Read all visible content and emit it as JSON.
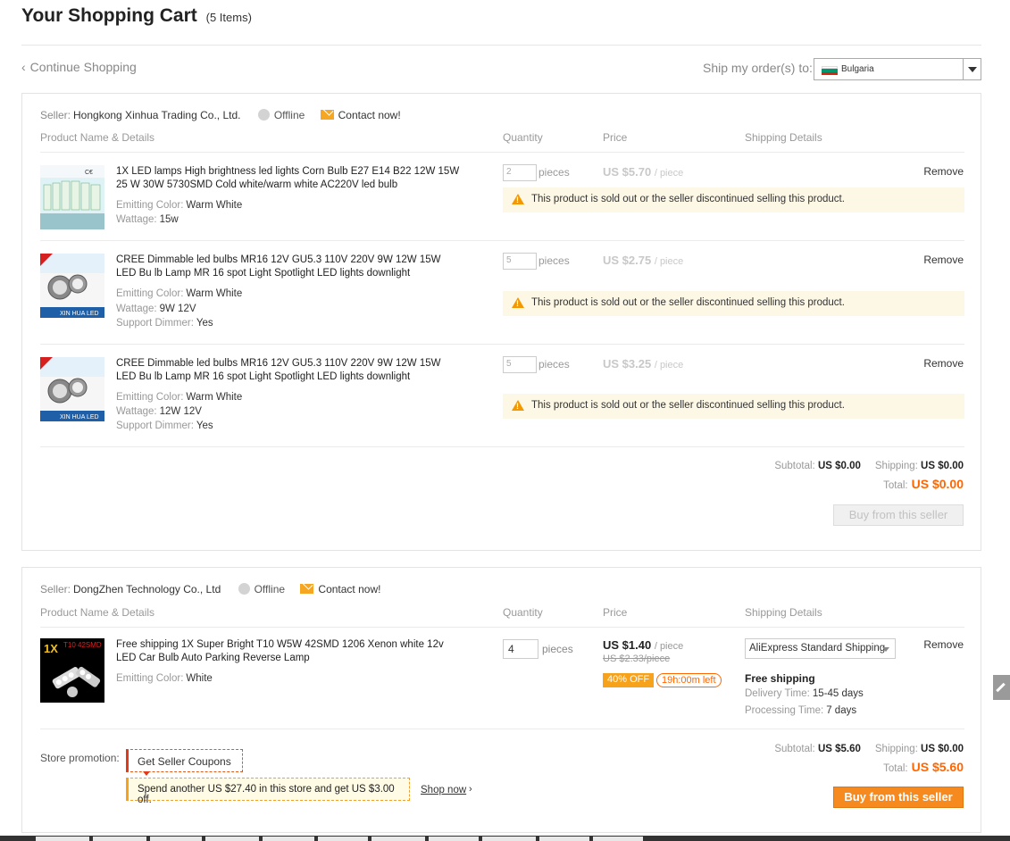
{
  "header": {
    "title": "Your Shopping Cart",
    "item_count": "(5 Items)",
    "continue_shopping": "Continue Shopping",
    "ship_to_label": "Ship my order(s) to:",
    "country": "Bulgaria"
  },
  "columns": {
    "product": "Product Name & Details",
    "quantity": "Quantity",
    "price": "Price",
    "shipping": "Shipping Details"
  },
  "stores": [
    {
      "seller_label": "Seller:",
      "seller_name": "Hongkong Xinhua Trading Co., Ltd.",
      "status": "Offline",
      "contact": "Contact now!",
      "items": [
        {
          "name": "1X LED lamps High brightness led lights Corn Bulb E27 E14 B22 12W 15W 25 W 30W 5730SMD Cold white/warm white AC220V led bulb",
          "attrs": [
            {
              "label": "Emitting Color:",
              "value": "Warm White"
            },
            {
              "label": "Wattage:",
              "value": "15w"
            }
          ],
          "quantity": "2",
          "unit": "pieces",
          "price": "US $5.70",
          "price_unit": "/ piece",
          "remove": "Remove",
          "warning": "This product is sold out or the seller discontinued selling this product."
        },
        {
          "name": "CREE Dimmable led bulbs MR16 12V GU5.3 110V 220V 9W 12W 15W LED Bu lb Lamp MR 16 spot Light Spotlight LED lights downlight",
          "attrs": [
            {
              "label": "Emitting Color:",
              "value": "Warm White"
            },
            {
              "label": "Wattage:",
              "value": "9W 12V"
            },
            {
              "label": "Support Dimmer:",
              "value": "Yes"
            }
          ],
          "quantity": "5",
          "unit": "pieces",
          "price": "US $2.75",
          "price_unit": "/ piece",
          "remove": "Remove",
          "warning": "This product is sold out or the seller discontinued selling this product."
        },
        {
          "name": "CREE Dimmable led bulbs MR16 12V GU5.3 110V 220V 9W 12W 15W LED Bu lb Lamp MR 16 spot Light Spotlight LED lights downlight",
          "attrs": [
            {
              "label": "Emitting Color:",
              "value": "Warm White"
            },
            {
              "label": "Wattage:",
              "value": "12W 12V"
            },
            {
              "label": "Support Dimmer:",
              "value": "Yes"
            }
          ],
          "quantity": "5",
          "unit": "pieces",
          "price": "US $3.25",
          "price_unit": "/ piece",
          "remove": "Remove",
          "warning": "This product is sold out or the seller discontinued selling this product."
        }
      ],
      "subtotal_label": "Subtotal:",
      "subtotal": "US $0.00",
      "shipping_label": "Shipping:",
      "shipping": "US $0.00",
      "total_label": "Total:",
      "total": "US $0.00",
      "buy_label": "Buy from this seller"
    },
    {
      "seller_label": "Seller:",
      "seller_name": "DongZhen Technology Co., Ltd",
      "status": "Offline",
      "contact": "Contact now!",
      "items": [
        {
          "name": "Free shipping 1X Super Bright T10 W5W 42SMD 1206 Xenon white 12v LED Car Bulb Auto Parking Reverse Lamp",
          "attrs": [
            {
              "label": "Emitting Color:",
              "value": "White"
            }
          ],
          "quantity": "4",
          "unit": "pieces",
          "price": "US $1.40",
          "price_unit": "/ piece",
          "old_price": "US $2.33/piece",
          "discount": "40% OFF",
          "time_left": "19h:00m left",
          "shipping_method": "AliExpress Standard Shipping",
          "free_shipping": "Free shipping",
          "delivery_label": "Delivery Time:",
          "delivery": "15-45 days",
          "processing_label": "Processing Time:",
          "processing": "7 days",
          "remove": "Remove",
          "thumb_text": "1X",
          "thumb_text2": "T10 42SMD"
        }
      ],
      "promo_label": "Store promotion:",
      "coupon_label": "Get Seller Coupons",
      "spend_text": "Spend another US $27.40 in this store and get US $3.00 off.",
      "shop_now": "Shop now",
      "subtotal_label": "Subtotal:",
      "subtotal": "US $5.60",
      "shipping_label": "Shipping:",
      "shipping": "US $0.00",
      "total_label": "Total:",
      "total": "US $5.60",
      "buy_label": "Buy from this seller"
    }
  ],
  "colors": {
    "accent_orange": "#ff6600",
    "button_orange": "#f68a1e",
    "warning_bg": "#fdf7e6"
  }
}
